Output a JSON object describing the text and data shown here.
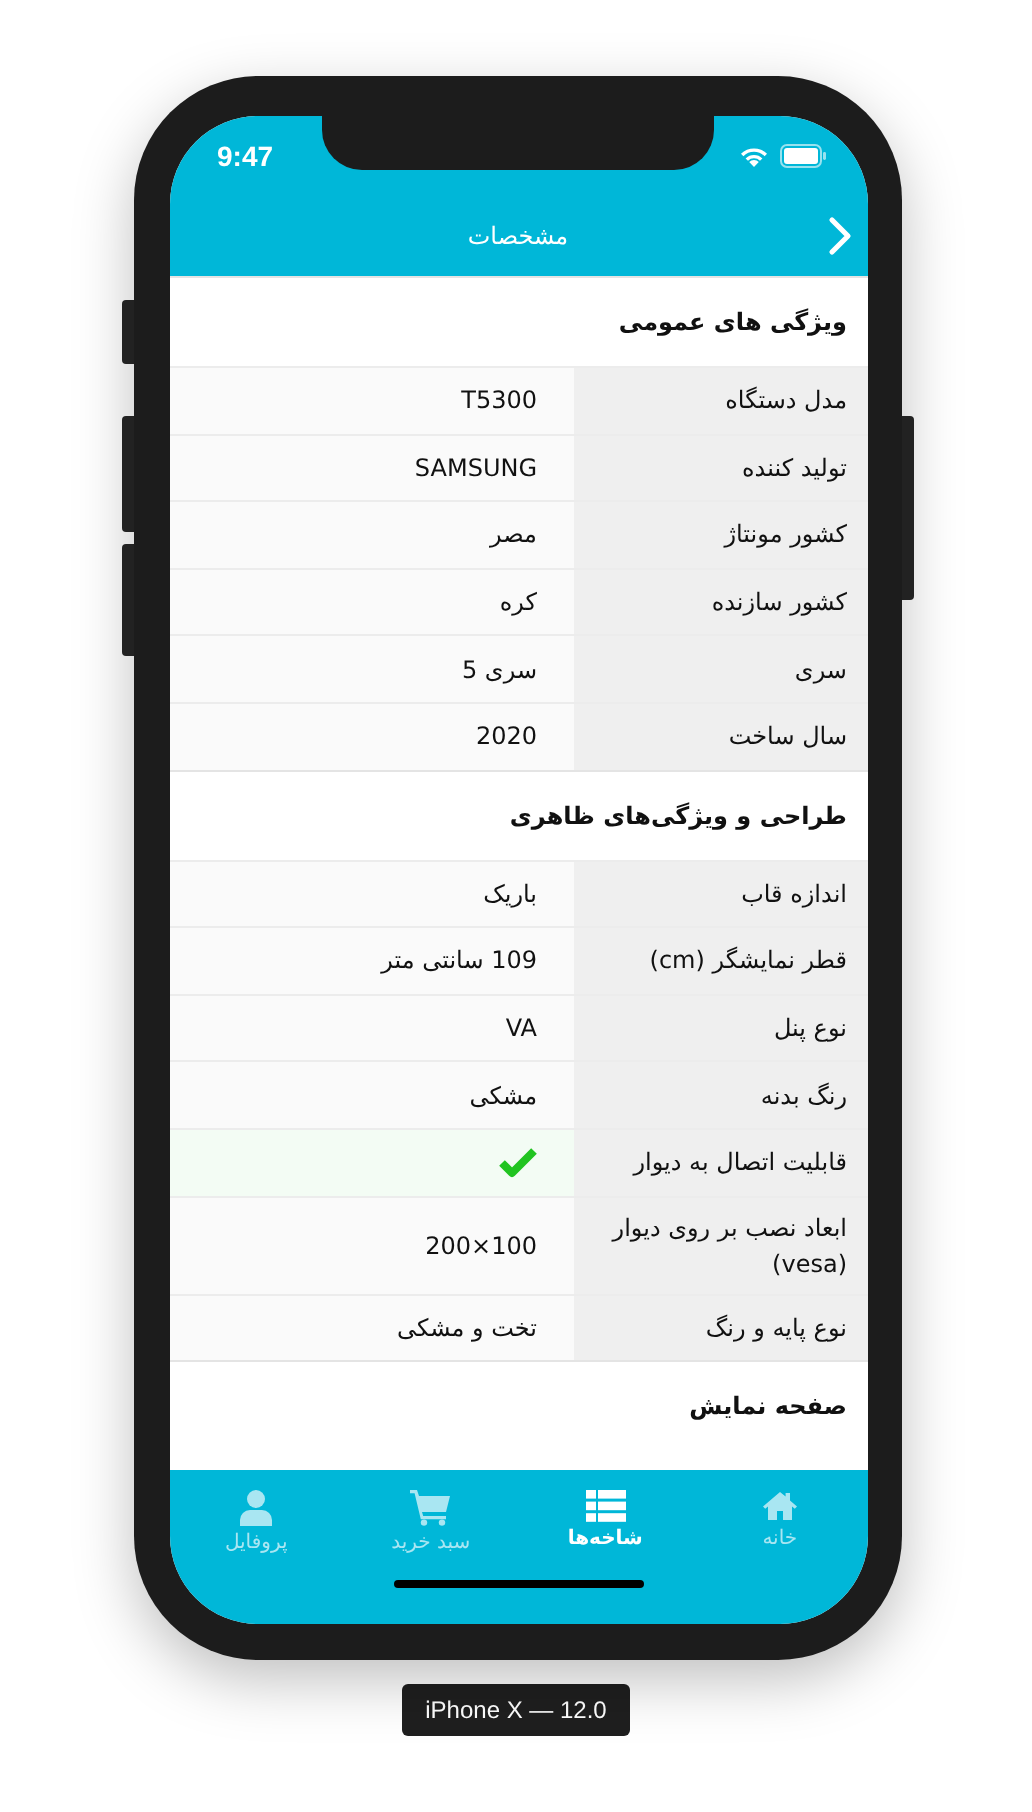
{
  "status_bar": {
    "time": "9:47"
  },
  "header": {
    "title": "مشخصات"
  },
  "sections": [
    {
      "title": "ویژگی های عمومی",
      "rows": [
        {
          "kind": "text",
          "label": "مدل دستگاه",
          "value": "T5300"
        },
        {
          "kind": "text",
          "label": "تولید کننده",
          "value": "SAMSUNG"
        },
        {
          "kind": "text",
          "label": "کشور مونتاژ",
          "value": "مصر"
        },
        {
          "kind": "text",
          "label": "کشور سازنده",
          "value": "کره"
        },
        {
          "kind": "text",
          "label": "سری",
          "value": "سری 5"
        },
        {
          "kind": "text",
          "label": "سال ساخت",
          "value": "2020"
        }
      ]
    },
    {
      "title": "طراحی و ویژگی‌های ظاهری",
      "rows": [
        {
          "kind": "text",
          "label": "اندازه قاب",
          "value": "باریک"
        },
        {
          "kind": "text",
          "label": "قطر نمایشگر (cm)",
          "value": "109 سانتی متر"
        },
        {
          "kind": "text",
          "label": "نوع پنل",
          "value": "VA"
        },
        {
          "kind": "text",
          "label": "رنگ بدنه",
          "value": "مشکی"
        },
        {
          "kind": "check",
          "label": "قابلیت اتصال به دیوار",
          "checked": true
        },
        {
          "kind": "text",
          "label": "ابعاد نصب بر روی دیوار (vesa)",
          "value": "200×100"
        },
        {
          "kind": "text",
          "label": "نوع پایه و رنگ",
          "value": "تخت و مشکی"
        }
      ]
    },
    {
      "title": "صفحه نمایش"
    }
  ],
  "tab_bar": [
    {
      "label": "خانه",
      "selected": false
    },
    {
      "label": "شاخه‌ها",
      "selected": true
    },
    {
      "label": "سبد خرید",
      "selected": false
    },
    {
      "label": "پروفایل",
      "selected": false
    }
  ],
  "device_caption": "iPhone X — 12.0"
}
